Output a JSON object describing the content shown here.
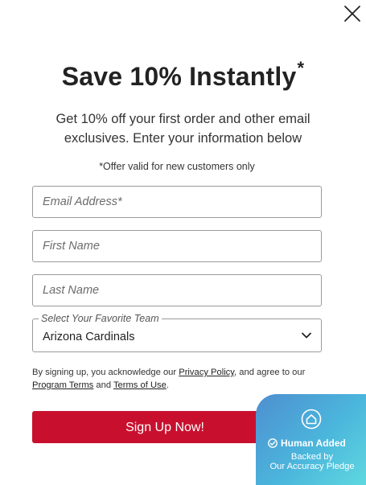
{
  "header": {
    "title": "Save 10% Instantly",
    "title_mark": "*",
    "subtitle": "Get 10% off your first order and other email exclusives. Enter your information below",
    "offer_note": "*Offer valid for new customers only"
  },
  "form": {
    "email_placeholder": "Email Address*",
    "first_name_placeholder": "First Name",
    "last_name_placeholder": "Last Name",
    "team_select_label": "Select Your Favorite Team",
    "team_select_value": "Arizona Cardinals"
  },
  "legal": {
    "prefix": "By signing up, you acknowledge our ",
    "privacy_link": "Privacy Policy",
    "middle": ", and agree to our ",
    "program_link": "Program Terms",
    "and": " and ",
    "terms_link": "Terms of Use",
    "suffix": "."
  },
  "submit": {
    "label": "Sign Up Now!",
    "color": "#c8102e"
  },
  "badge": {
    "title": "Human Added",
    "line1": "Backed by",
    "line2": "Our Accuracy Pledge",
    "icon": "house-outline-icon",
    "check_icon": "check-circle-icon"
  },
  "icons": {
    "close": "close-icon",
    "dropdown": "chevron-down-icon"
  }
}
